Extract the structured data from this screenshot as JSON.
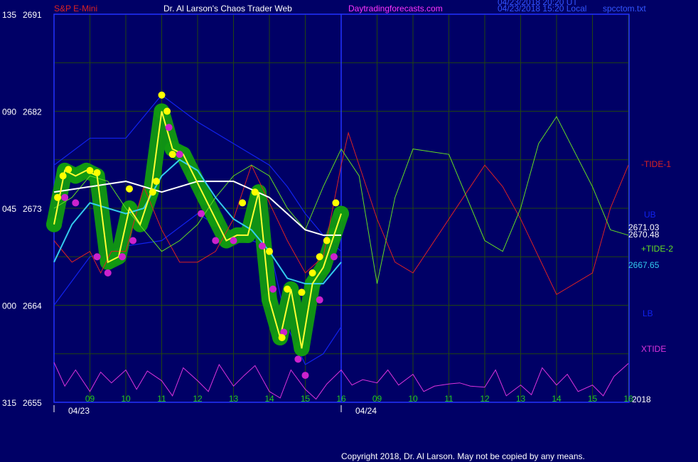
{
  "header": {
    "instrument": "S&P E-Mini",
    "author": "Dr. Al Larson's Chaos Trader Web",
    "site": "Daytradingforecasts.com",
    "stamp_ut": "04/23/2018 20:20 UT",
    "stamp_local": "04/23/2018 15:20 Local",
    "datafile": "spcctom.txt"
  },
  "footer": {
    "copyright": "Copyright 2018, Dr. Al Larson. May not be copied by any means."
  },
  "colors": {
    "background": "#000066",
    "frame": "#2233ff",
    "grid": "#224411",
    "price": "#ffff33",
    "bands": "#1122ee",
    "ma_cyan": "#33ccee",
    "ma_white": "#ffffff",
    "tide1": "#dd2222",
    "tide2": "#66dd22",
    "xtide": "#dd33dd",
    "dot_yellow": "#ffff00",
    "dot_magenta": "#cc22cc",
    "halo_green": "#119911"
  },
  "chart_data": {
    "type": "line",
    "ylim": [
      2655,
      2691
    ],
    "y_ticks": [
      {
        "left": "135",
        "price": "2691",
        "value": 2691
      },
      {
        "left": "090",
        "price": "2682",
        "value": 2682
      },
      {
        "left": "045",
        "price": "2673",
        "value": 2673
      },
      {
        "left": "000",
        "price": "2664",
        "value": 2664
      },
      {
        "left": "315",
        "price": "2655",
        "value": 2655
      }
    ],
    "x_ticks": [
      "09",
      "10",
      "11",
      "12",
      "13",
      "14",
      "15",
      "16",
      "09",
      "10",
      "11",
      "12",
      "13",
      "14",
      "15",
      "16"
    ],
    "date_labels": [
      "04/23",
      "04/24"
    ],
    "year_label": "2018",
    "value_labels": [
      {
        "text": "2671.03",
        "value": 2671.03
      },
      {
        "text": "2670.48",
        "value": 2670.48
      },
      {
        "text": "2667.65",
        "value": 2667.65
      }
    ],
    "series_labels": [
      "-TIDE-1",
      "UB",
      "+TIDE-2",
      "LB",
      "XTIDE"
    ],
    "series": [
      {
        "name": "price",
        "x": [
          0,
          0.3,
          0.6,
          0.9,
          1.2,
          1.5,
          1.8,
          2.1,
          2.4,
          2.7,
          3.0,
          3.3,
          3.6,
          3.9,
          4.2,
          4.5,
          4.8,
          5.1,
          5.4,
          5.7,
          6.0,
          6.3,
          6.6,
          6.9,
          7.2,
          7.5,
          7.8,
          8.0
        ],
        "values": [
          2671.5,
          2676.5,
          2676.0,
          2676.5,
          2676.0,
          2668.0,
          2668.5,
          2673.0,
          2671.5,
          2674.5,
          2682.0,
          2678.5,
          2678.0,
          2676.0,
          2674.0,
          2672.0,
          2670.0,
          2670.5,
          2670.5,
          2674.5,
          2664.5,
          2661.0,
          2665.5,
          2660.0,
          2666.0,
          2667.5,
          2670.5,
          2672.5
        ]
      },
      {
        "name": "ma_cyan",
        "x": [
          0,
          0.5,
          1,
          1.5,
          2,
          2.5,
          3,
          3.5,
          4,
          4.5,
          5,
          5.5,
          6,
          6.5,
          7,
          7.5,
          8
        ],
        "values": [
          2668.0,
          2671.5,
          2673.5,
          2673.0,
          2672.5,
          2673.0,
          2676.0,
          2677.5,
          2676.5,
          2674.0,
          2672.0,
          2671.0,
          2669.0,
          2666.5,
          2666.0,
          2666.0,
          2668.0
        ]
      },
      {
        "name": "ma_white",
        "x": [
          0,
          1,
          2,
          3,
          4,
          5,
          6,
          6.5,
          7,
          7.5,
          8
        ],
        "values": [
          2674.5,
          2675.0,
          2675.5,
          2674.5,
          2675.5,
          2675.5,
          2674.0,
          2672.5,
          2671.0,
          2670.5,
          2670.5
        ]
      },
      {
        "name": "UB",
        "x": [
          0,
          1,
          2,
          3,
          4,
          5,
          6,
          6.5,
          7,
          7.5,
          8
        ],
        "values": [
          2677.0,
          2679.5,
          2679.5,
          2683.5,
          2681.0,
          2679.0,
          2677.0,
          2675.0,
          2672.5,
          2670.5,
          2669.0
        ]
      },
      {
        "name": "LB",
        "x": [
          0,
          1,
          2,
          3,
          4,
          5,
          6,
          6.5,
          7,
          7.5,
          8
        ],
        "values": [
          2664.0,
          2668.5,
          2669.5,
          2670.0,
          2672.5,
          2670.5,
          2669.5,
          2662.0,
          2658.5,
          2659.5,
          2662.0
        ]
      },
      {
        "name": "-TIDE-1",
        "x": [
          0,
          0.5,
          1,
          1.3,
          1.6,
          2,
          2.5,
          3,
          3.5,
          4,
          4.5,
          5,
          5.5,
          6,
          6.5,
          7,
          7.5,
          8,
          8.2,
          8.6,
          9,
          9.5,
          10,
          11,
          12,
          12.5,
          13,
          14,
          15,
          15.5,
          16
        ],
        "values": [
          2670.0,
          2668.0,
          2669.0,
          2667.0,
          2669.0,
          2669.0,
          2675.0,
          2671.0,
          2668.0,
          2668.0,
          2669.0,
          2672.0,
          2677.0,
          2673.5,
          2670.0,
          2667.0,
          2668.5,
          2677.0,
          2680.0,
          2676.0,
          2672.0,
          2668.0,
          2667.0,
          2672.0,
          2677.0,
          2675.0,
          2672.0,
          2665.0,
          2667.0,
          2673.0,
          2677.0
        ]
      },
      {
        "name": "+TIDE-2",
        "x": [
          0,
          0.5,
          1,
          1.5,
          2,
          2.5,
          3,
          3.5,
          4,
          4.5,
          5,
          5.5,
          6,
          6.5,
          7,
          7.5,
          8,
          8.5,
          9,
          9.5,
          10,
          11,
          12,
          12.5,
          13,
          13.5,
          14,
          15,
          15.5,
          16
        ],
        "values": [
          2673.0,
          2674.0,
          2676.0,
          2675.5,
          2673.0,
          2671.0,
          2669.0,
          2670.0,
          2671.5,
          2674.0,
          2676.0,
          2677.0,
          2676.0,
          2673.0,
          2671.0,
          2675.0,
          2678.5,
          2676.0,
          2666.0,
          2674.0,
          2678.5,
          2678.0,
          2670.0,
          2669.0,
          2673.0,
          2679.0,
          2681.5,
          2675.0,
          2671.0,
          2670.5
        ]
      },
      {
        "name": "XTIDE",
        "x": [
          0,
          0.3,
          0.6,
          1,
          1.3,
          1.6,
          2,
          2.3,
          2.6,
          3,
          3.3,
          3.6,
          4,
          4.3,
          4.6,
          5,
          5.3,
          5.6,
          6,
          6.3,
          6.6,
          7,
          7.3,
          7.6,
          8,
          8.3,
          8.6,
          9,
          9.3,
          9.6,
          10,
          10.3,
          10.6,
          11,
          11.3,
          11.6,
          12,
          12.3,
          12.6,
          13,
          13.3,
          13.6,
          14,
          14.3,
          14.6,
          15,
          15.3,
          15.6,
          16
        ],
        "values": [
          2658.7,
          2656.5,
          2658.0,
          2656.0,
          2657.8,
          2656.8,
          2658.0,
          2656.2,
          2657.9,
          2657.0,
          2655.6,
          2658.2,
          2657.0,
          2656.0,
          2658.5,
          2656.5,
          2657.5,
          2658.4,
          2656.0,
          2655.4,
          2658.0,
          2656.2,
          2655.3,
          2656.7,
          2658.0,
          2656.6,
          2657.1,
          2656.8,
          2658.0,
          2656.6,
          2657.6,
          2656.0,
          2656.5,
          2656.7,
          2656.8,
          2656.5,
          2656.4,
          2658.0,
          2655.6,
          2656.6,
          2655.7,
          2658.2,
          2656.6,
          2657.6,
          2656.0,
          2656.6,
          2655.6,
          2657.4,
          2658.6
        ]
      }
    ],
    "dots_yellow": [
      [
        0.1,
        2674
      ],
      [
        0.25,
        2676
      ],
      [
        0.4,
        2676.6
      ],
      [
        1.0,
        2676.5
      ],
      [
        1.2,
        2676.3
      ],
      [
        2.1,
        2674.8
      ],
      [
        2.75,
        2674.5
      ],
      [
        2.85,
        2675.5
      ],
      [
        3.0,
        2683.5
      ],
      [
        3.15,
        2682.0
      ],
      [
        3.3,
        2678.0
      ],
      [
        5.25,
        2673.5
      ],
      [
        5.6,
        2674.5
      ],
      [
        6.0,
        2669.0
      ],
      [
        6.35,
        2661.0
      ],
      [
        6.5,
        2665.5
      ],
      [
        6.9,
        2665.2
      ],
      [
        7.2,
        2667.0
      ],
      [
        7.4,
        2668.5
      ],
      [
        7.6,
        2670.0
      ],
      [
        7.85,
        2673.5
      ]
    ],
    "dots_magenta": [
      [
        0.3,
        2674.0
      ],
      [
        0.6,
        2673.5
      ],
      [
        1.2,
        2668.5
      ],
      [
        1.5,
        2667.0
      ],
      [
        1.9,
        2668.5
      ],
      [
        2.2,
        2670.0
      ],
      [
        3.2,
        2680.5
      ],
      [
        3.5,
        2678.0
      ],
      [
        4.1,
        2672.5
      ],
      [
        4.5,
        2670.0
      ],
      [
        5.0,
        2670.0
      ],
      [
        5.8,
        2669.5
      ],
      [
        6.1,
        2665.5
      ],
      [
        6.4,
        2661.5
      ],
      [
        6.8,
        2659.0
      ],
      [
        7.0,
        2657.5
      ],
      [
        7.4,
        2664.5
      ],
      [
        7.8,
        2668.5
      ]
    ]
  }
}
